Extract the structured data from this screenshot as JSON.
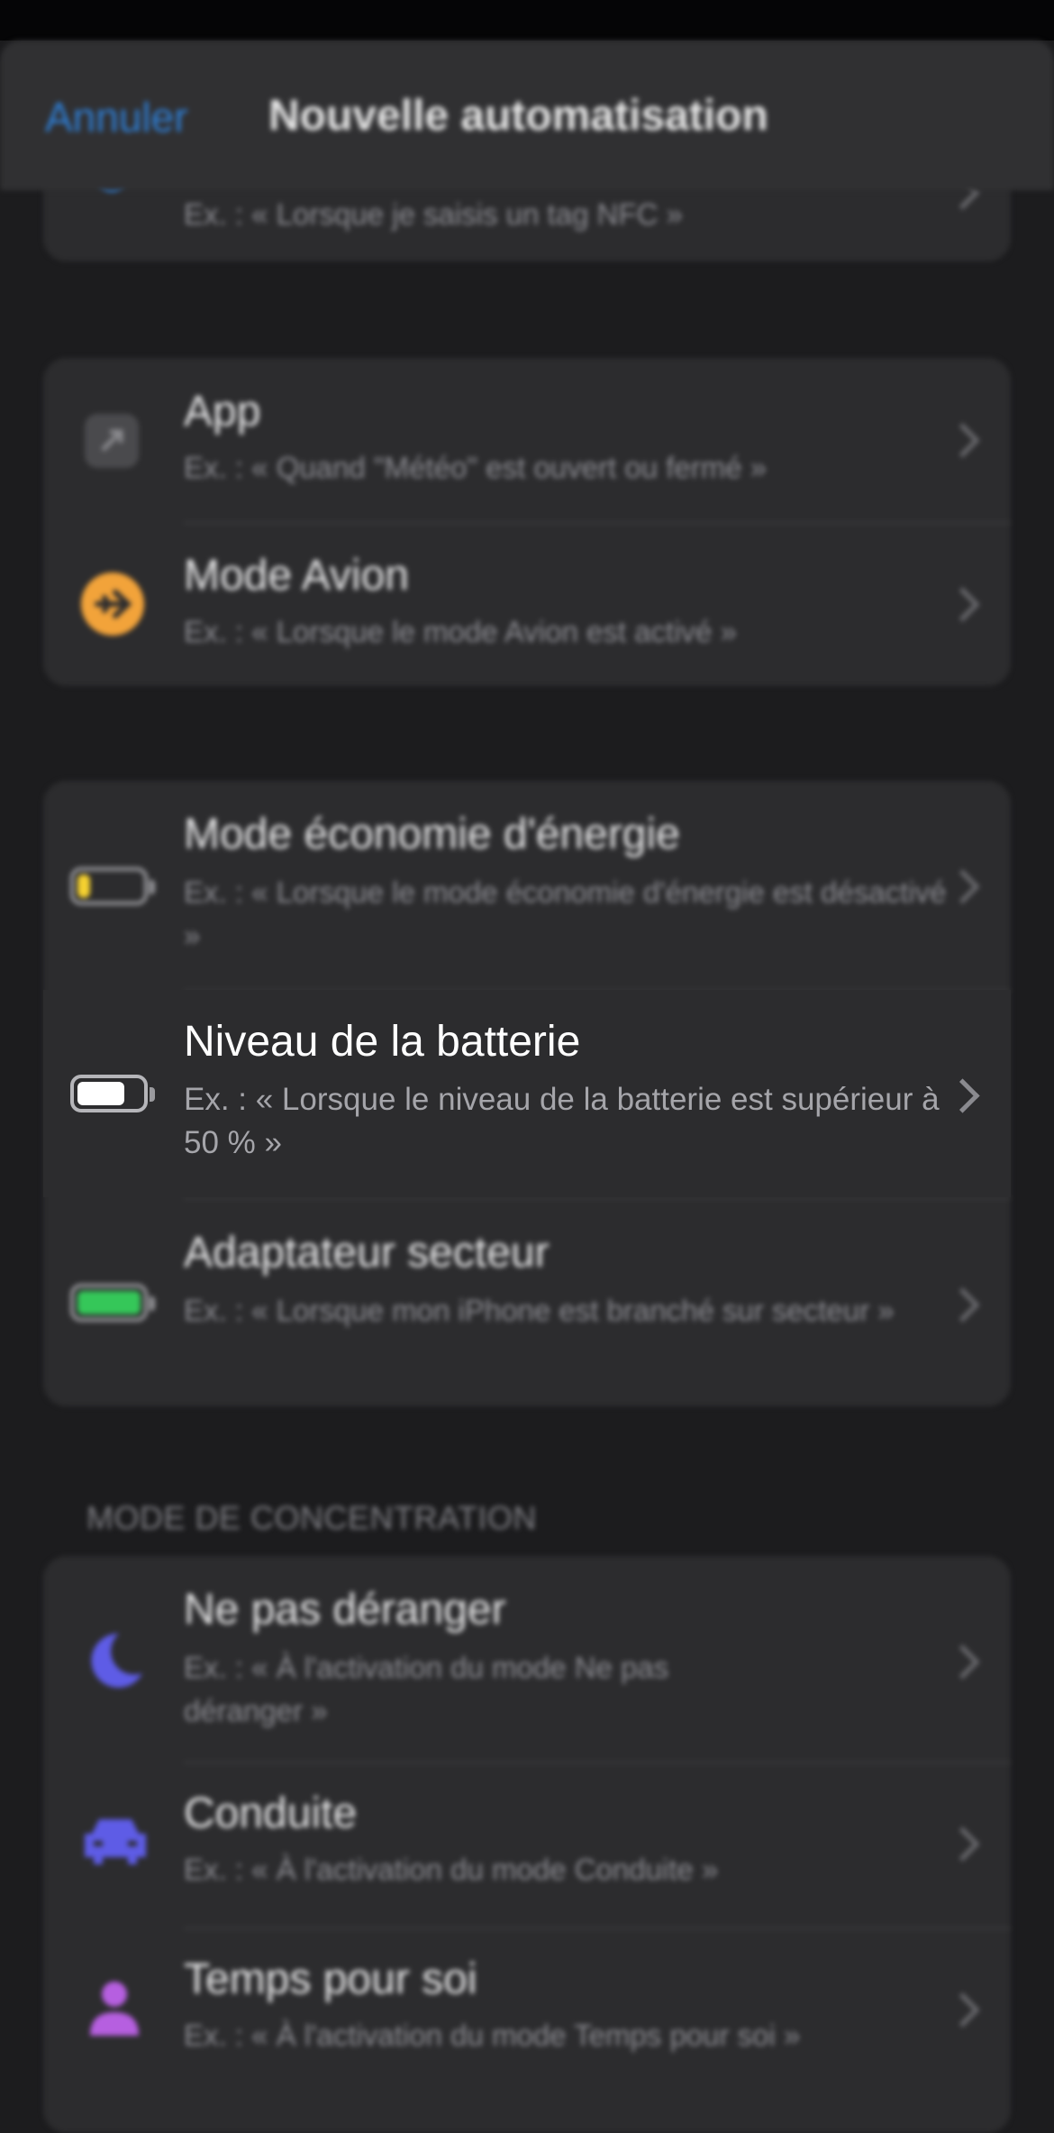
{
  "nav": {
    "cancel_label": "Annuler",
    "title": "Nouvelle automatisation"
  },
  "nfc_card": {
    "subtitle": "Ex. : « Lorsque je saisis un tag NFC »"
  },
  "group1": [
    {
      "title": "App",
      "subtitle": "Ex. : « Quand \"Météo\" est ouvert ou fermé »",
      "icon": "app-icon"
    },
    {
      "title": "Mode Avion",
      "subtitle": "Ex. : « Lorsque le mode Avion est activé »",
      "icon": "airplane-icon"
    }
  ],
  "group2": [
    {
      "title": "Mode économie d'énergie",
      "subtitle": "Ex. : « Lorsque le mode économie d'énergie est désactivé »",
      "icon": "low-power-battery-icon"
    },
    {
      "title": "Niveau de la batterie",
      "subtitle": "Ex. : « Lorsque le niveau de la batterie est supérieur à 50 % »",
      "icon": "battery-icon"
    },
    {
      "title": "Adaptateur secteur",
      "subtitle": "Ex. : « Lorsque mon iPhone est branché sur secteur »",
      "icon": "charging-battery-icon"
    }
  ],
  "focus_section": {
    "header": "MODE DE CONCENTRATION",
    "items": [
      {
        "title": "Ne pas déranger",
        "subtitle": "Ex. : « À l'activation du mode Ne pas déranger »",
        "icon": "moon-icon"
      },
      {
        "title": "Conduite",
        "subtitle": "Ex. : « À l'activation du mode Conduite »",
        "icon": "car-icon"
      },
      {
        "title": "Temps pour soi",
        "subtitle": "Ex. : « À l'activation du mode Temps pour soi »",
        "icon": "person-icon"
      }
    ]
  },
  "colors": {
    "accent_blue": "#2f7fd6",
    "airplane_orange": "#f2a33a",
    "low_power_yellow": "#f5d130",
    "charging_green": "#35c759",
    "focus_purple": "#5e5ce6",
    "personal_purple": "#b65fe0"
  }
}
